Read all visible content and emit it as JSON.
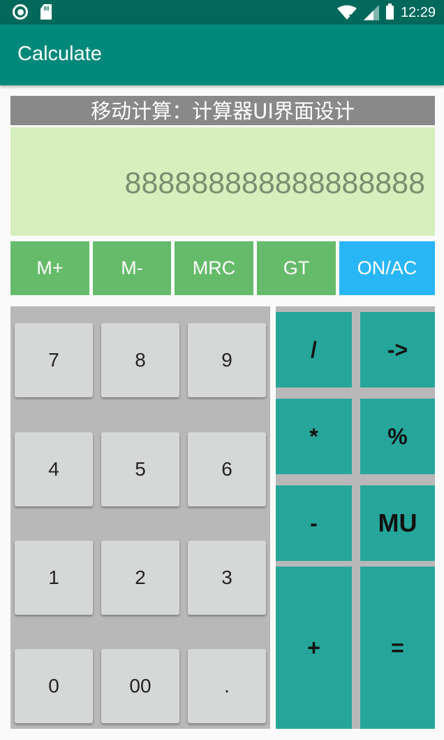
{
  "status_bar": {
    "time": "12:29"
  },
  "app_bar": {
    "title": "Calculate"
  },
  "header": {
    "text": "移动计算：计算器UI界面设计"
  },
  "display": {
    "value": "888888888888888888"
  },
  "memory_buttons": [
    "M+",
    "M-",
    "MRC",
    "GT",
    "ON/AC"
  ],
  "number_keys": [
    "7",
    "8",
    "9",
    "4",
    "5",
    "6",
    "1",
    "2",
    "3",
    "0",
    "00",
    "."
  ],
  "operator_keys": [
    "/",
    "->",
    "*",
    "%",
    "-",
    "MU",
    "+",
    "="
  ],
  "colors": {
    "status_bar": "#00695c",
    "app_bar": "#00897b",
    "header": "#898989",
    "display": "#d6efbc",
    "memory_button": "#66bb6a",
    "onac_button": "#29b6f6",
    "operator_button": "#26a69a",
    "number_button": "#d6d7d7",
    "pad_background": "#b8b8b8"
  }
}
